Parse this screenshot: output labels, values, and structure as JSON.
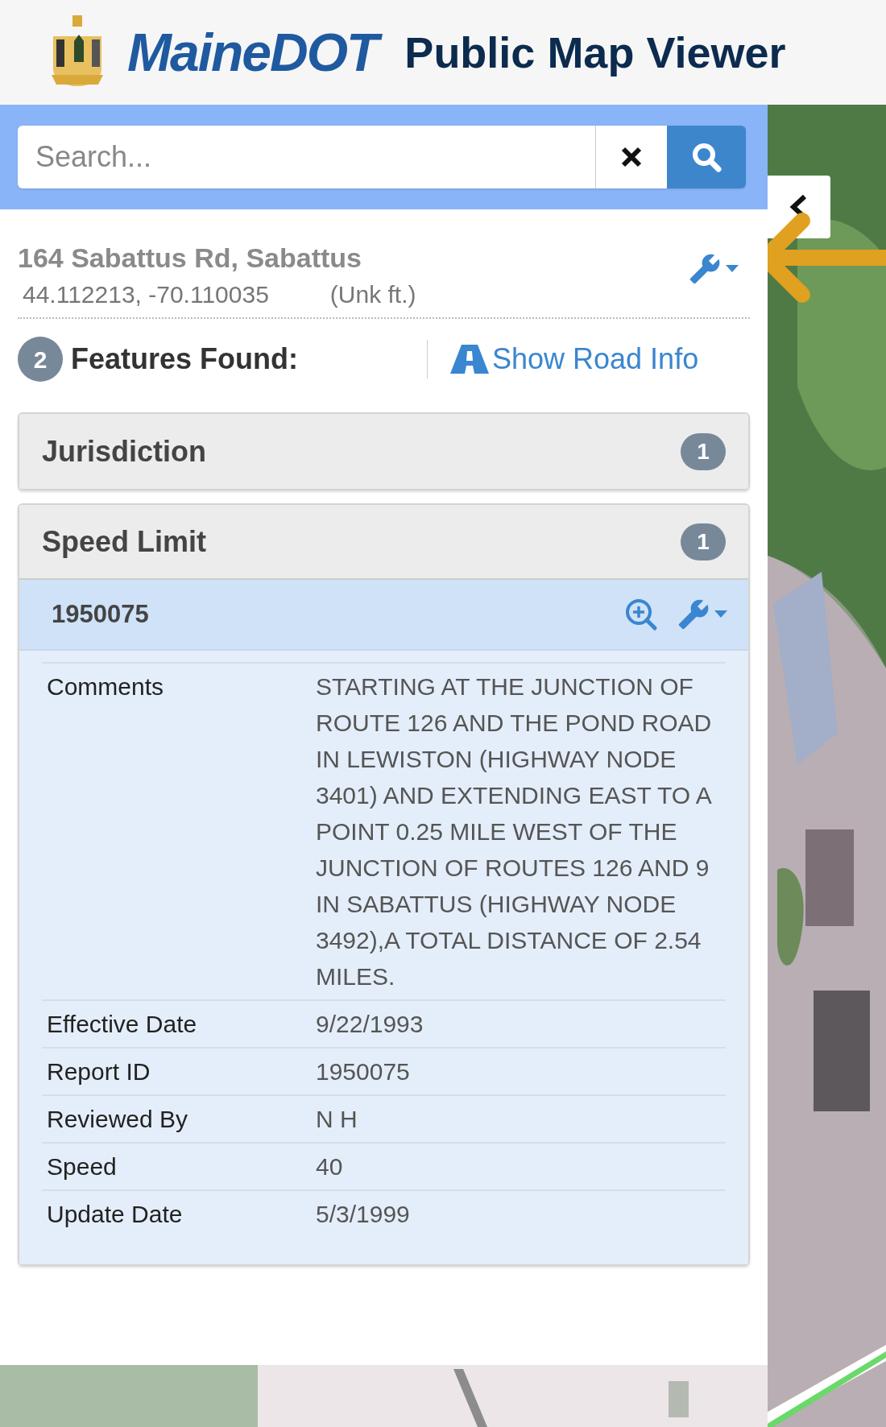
{
  "header": {
    "logo_text": "MaineDOT",
    "title": "Public Map Viewer"
  },
  "search": {
    "placeholder": "Search..."
  },
  "location": {
    "address": "164 Sabattus Rd, Sabattus",
    "coordinates": "44.112213, -70.110035",
    "elevation": "(Unk ft.)"
  },
  "features": {
    "count": "2",
    "label": "Features Found:",
    "road_info_link": "Show Road Info"
  },
  "layers": [
    {
      "title": "Jurisdiction",
      "count": "1",
      "expanded": false
    },
    {
      "title": "Speed Limit",
      "count": "1",
      "expanded": true,
      "record": {
        "id": "1950075",
        "attributes": [
          {
            "label": "Comments",
            "value": "STARTING AT THE JUNCTION OF ROUTE 126 AND THE POND ROAD IN LEWISTON (HIGHWAY NODE 3401) AND EXTENDING EAST TO A POINT 0.25 MILE WEST OF THE JUNCTION OF ROUTES 126 AND 9 IN SABATTUS (HIGHWAY NODE 3492),A TOTAL DISTANCE OF 2.54 MILES."
          },
          {
            "label": "Effective Date",
            "value": "9/22/1993"
          },
          {
            "label": "Report ID",
            "value": "1950075"
          },
          {
            "label": "Reviewed By",
            "value": "N H"
          },
          {
            "label": "Speed",
            "value": "40"
          },
          {
            "label": "Update Date",
            "value": "5/3/1999"
          }
        ]
      }
    }
  ]
}
